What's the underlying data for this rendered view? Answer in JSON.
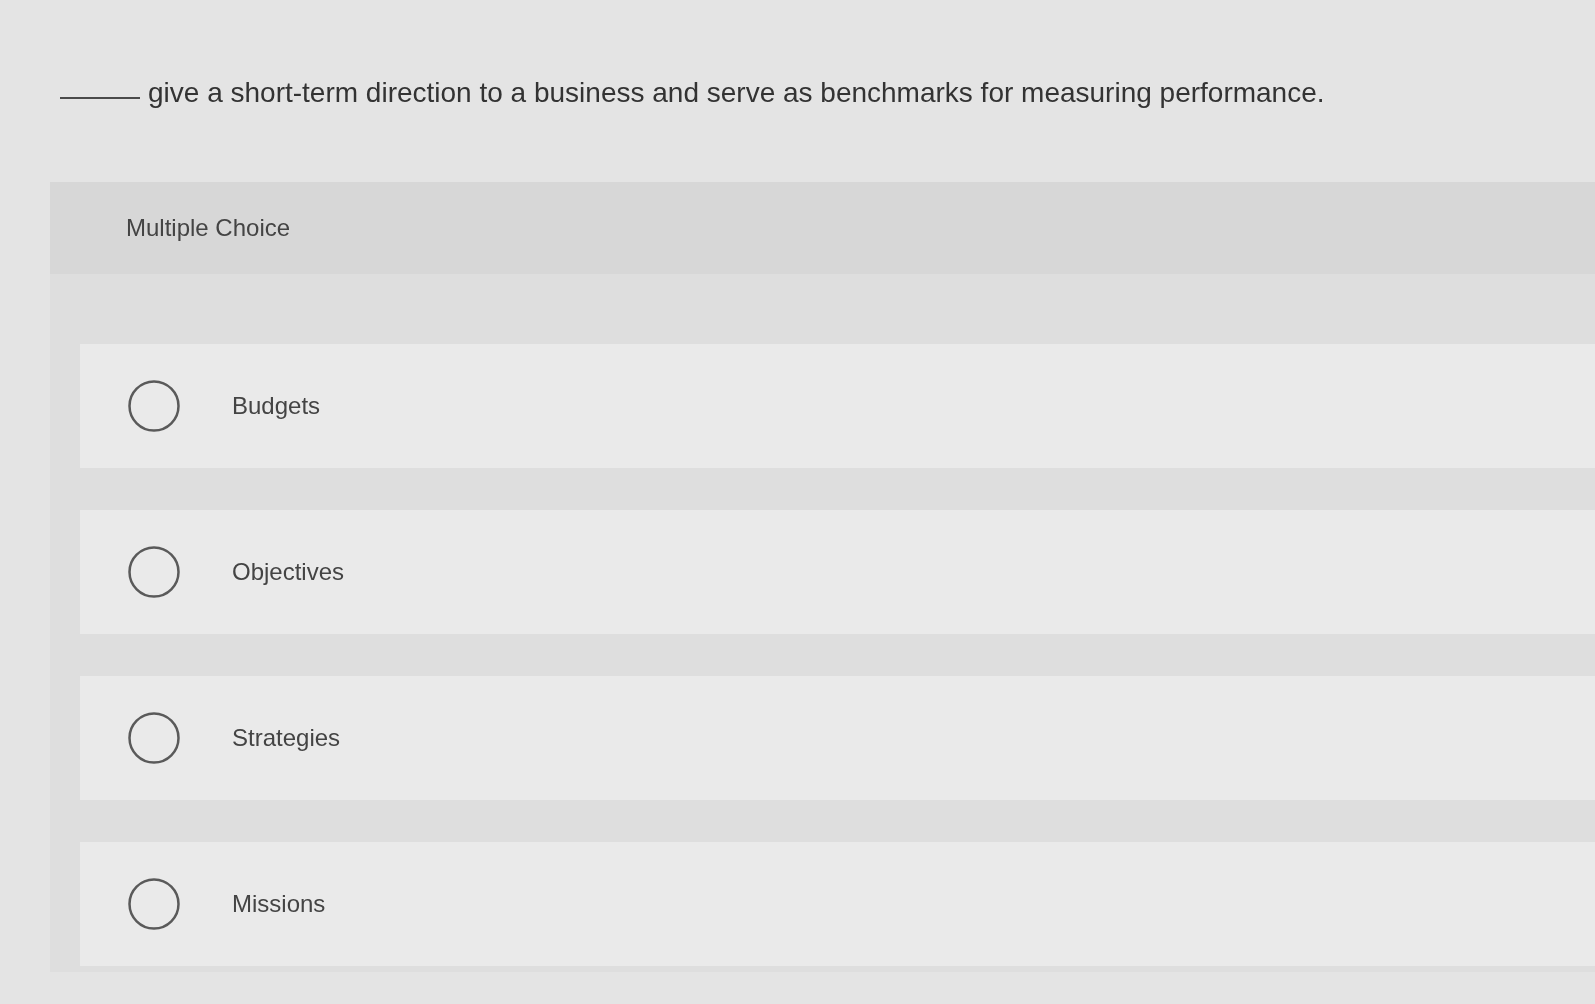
{
  "question": {
    "blank": true,
    "text": "give a short-term direction to a business and serve as benchmarks for measuring performance."
  },
  "answer_panel": {
    "heading": "Multiple Choice",
    "options": [
      {
        "label": "Budgets",
        "selected": false
      },
      {
        "label": "Objectives",
        "selected": false
      },
      {
        "label": "Strategies",
        "selected": false
      },
      {
        "label": "Missions",
        "selected": false
      }
    ]
  }
}
